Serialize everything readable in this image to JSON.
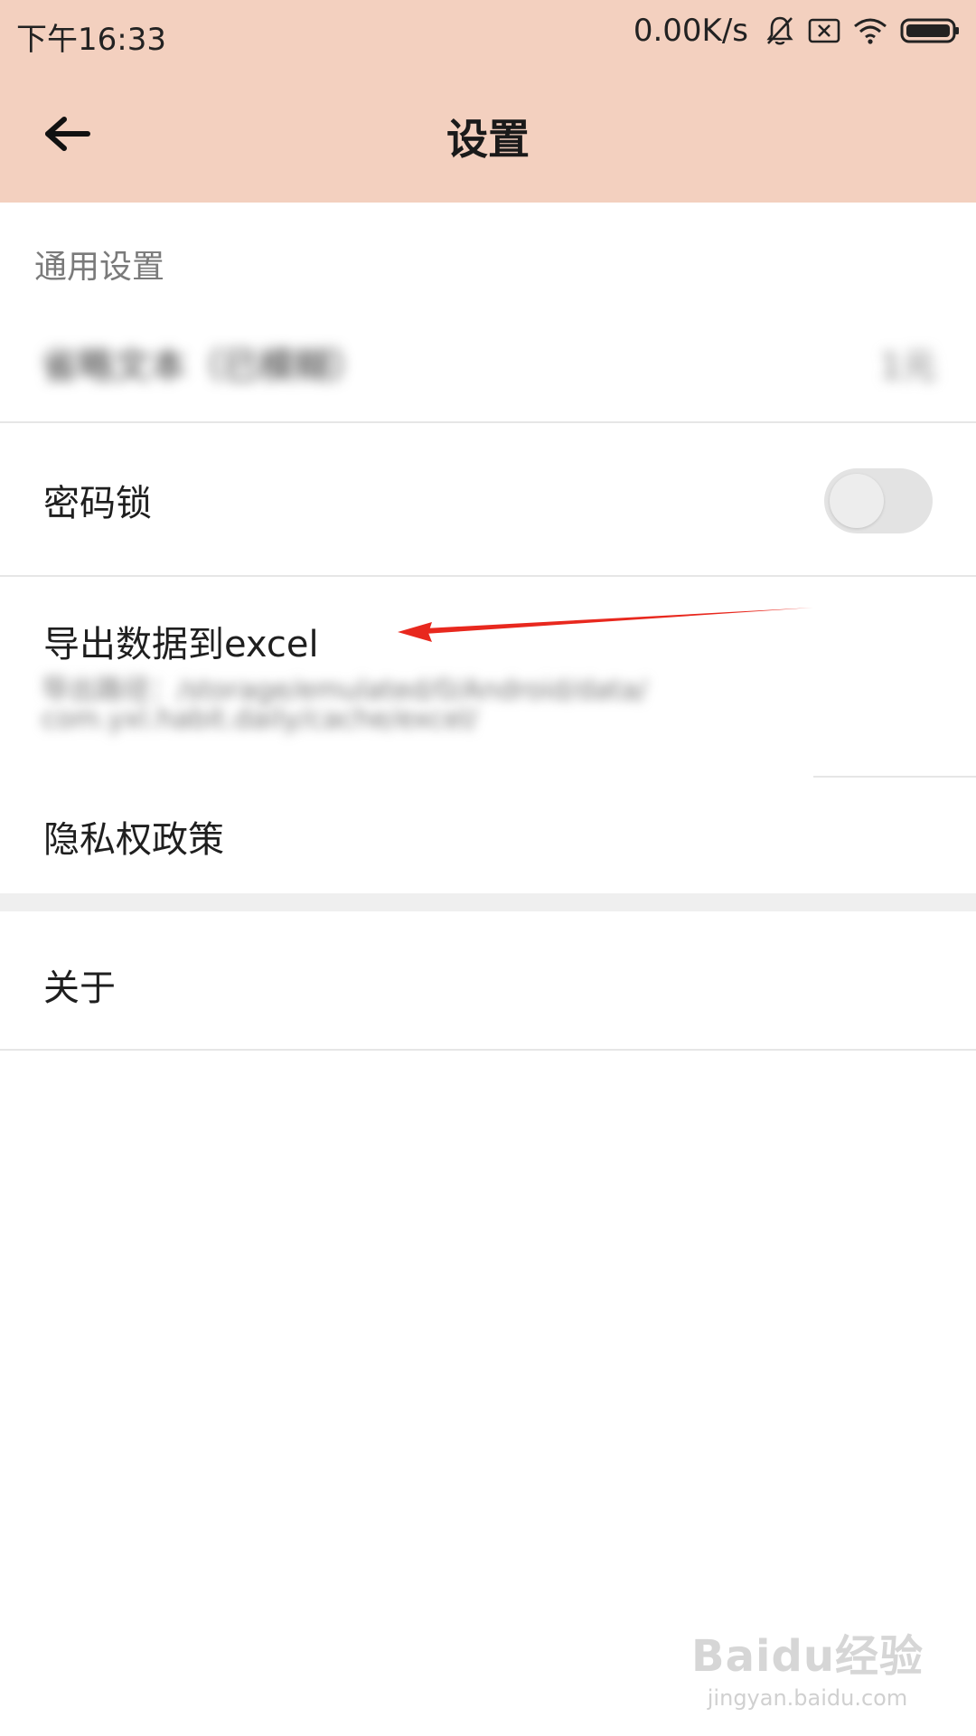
{
  "status_bar": {
    "time": "下午16:33",
    "network_speed": "0.00K/s",
    "icons": [
      "bell-off-icon",
      "sim-x-icon",
      "wifi-icon",
      "battery-icon"
    ]
  },
  "app_bar": {
    "title": "设置",
    "back_icon": "arrow-left-icon"
  },
  "section": {
    "title": "通用设置"
  },
  "rows": {
    "blurred_setting": {
      "label": "省略文本（已模糊）",
      "value": "1元"
    },
    "password_lock": {
      "label": "密码锁",
      "toggle_on": false
    },
    "export_excel": {
      "label": "导出数据到excel",
      "subtitle_line1": "导出路径：/storage/emulated/0/Android/data/",
      "subtitle_line2": "com.yxl.habit.daily/cache/excel/"
    },
    "privacy": {
      "label": "隐私权政策"
    },
    "about": {
      "label": "关于"
    }
  },
  "annotation": {
    "arrow_color": "#e8281e"
  },
  "watermark": {
    "main": "Baidu经验",
    "sub": "jingyan.baidu.com"
  },
  "colors": {
    "header_bg": "#f3d0bf",
    "divider": "#e6e6e6",
    "section_title": "#7a7a7a"
  }
}
